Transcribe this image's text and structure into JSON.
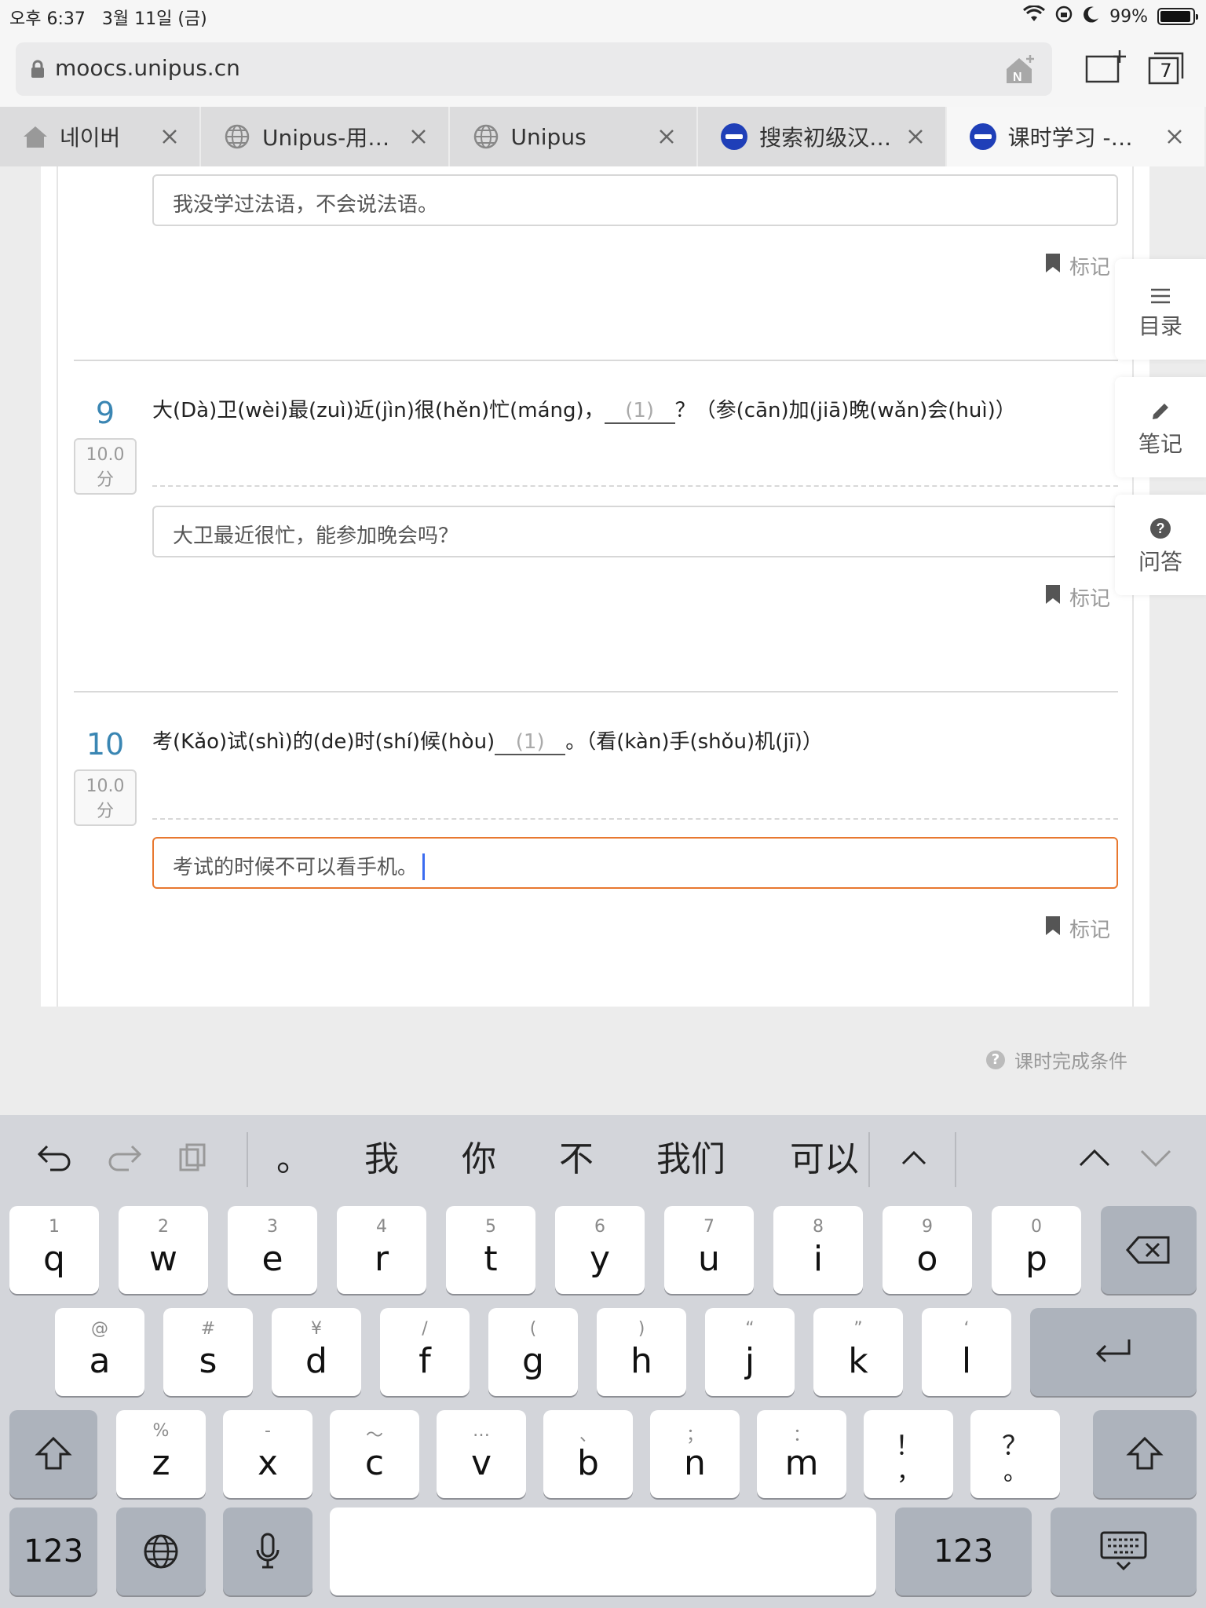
{
  "status": {
    "time": "오후 6:37",
    "date": "3월 11일 (금)",
    "battery": "99%"
  },
  "browser": {
    "url": "moocs.unipus.cn",
    "tab_count": "7"
  },
  "tabs": [
    {
      "label": "네이버",
      "icon": "home-icon"
    },
    {
      "label": "Unipus-用…",
      "icon": "globe-icon"
    },
    {
      "label": "Unipus",
      "icon": "globe-icon"
    },
    {
      "label": "搜索初级汉…",
      "icon": "unipus-logo-icon"
    },
    {
      "label": "课时学习 -…",
      "icon": "unipus-logo-icon"
    }
  ],
  "questions": {
    "prev_answer": "我没学过法语，不会说法语。",
    "mark_label": "标记",
    "q9": {
      "number": "9",
      "score": "10.0",
      "score_unit": "分",
      "text_before": "大(Dà)卫(wèi)最(zuì)近(jìn)很(hěn)忙(máng)，",
      "blank": "(1)",
      "text_after": "？（参(cān)加(jiā)晚(wǎn)会(huì)）",
      "answer": "大卫最近很忙，能参加晚会吗？"
    },
    "q10": {
      "number": "10",
      "score": "10.0",
      "score_unit": "分",
      "text_before": "考(Kǎo)试(shì)的(de)时(shí)候(hòu)",
      "blank": "(1)",
      "text_after": "。（看(kàn)手(shǒu)机(jī)）",
      "answer": "考试的时候不可以看手机。"
    }
  },
  "side_tools": {
    "toc": "目录",
    "notes": "笔记",
    "qa": "问答"
  },
  "complete_label": "课时完成条件",
  "keyboard": {
    "suggestions": [
      "。",
      "我",
      "你",
      "不",
      "我们",
      "可以"
    ],
    "row1": [
      {
        "hint": "1",
        "key": "q"
      },
      {
        "hint": "2",
        "key": "w"
      },
      {
        "hint": "3",
        "key": "e"
      },
      {
        "hint": "4",
        "key": "r"
      },
      {
        "hint": "5",
        "key": "t"
      },
      {
        "hint": "6",
        "key": "y"
      },
      {
        "hint": "7",
        "key": "u"
      },
      {
        "hint": "8",
        "key": "i"
      },
      {
        "hint": "9",
        "key": "o"
      },
      {
        "hint": "0",
        "key": "p"
      }
    ],
    "row2": [
      {
        "hint": "@",
        "key": "a"
      },
      {
        "hint": "#",
        "key": "s"
      },
      {
        "hint": "¥",
        "key": "d"
      },
      {
        "hint": "/",
        "key": "f"
      },
      {
        "hint": "(",
        "key": "g"
      },
      {
        "hint": ")",
        "key": "h"
      },
      {
        "hint": "“",
        "key": "j"
      },
      {
        "hint": "”",
        "key": "k"
      },
      {
        "hint": "‘",
        "key": "l"
      }
    ],
    "row3": [
      {
        "hint": "%",
        "key": "z"
      },
      {
        "hint": "-",
        "key": "x"
      },
      {
        "hint": "～",
        "key": "c"
      },
      {
        "hint": "…",
        "key": "v"
      },
      {
        "hint": "、",
        "key": "b"
      },
      {
        "hint": "；",
        "key": "n"
      },
      {
        "hint": "：",
        "key": "m"
      },
      {
        "hint": "！",
        "key": "，"
      },
      {
        "hint": "？",
        "key": "。"
      }
    ],
    "numbers_label": "123"
  },
  "colors": {
    "focus_border": "#e8782f",
    "question_number": "#3a86b3",
    "caret": "#3b6cf0"
  }
}
